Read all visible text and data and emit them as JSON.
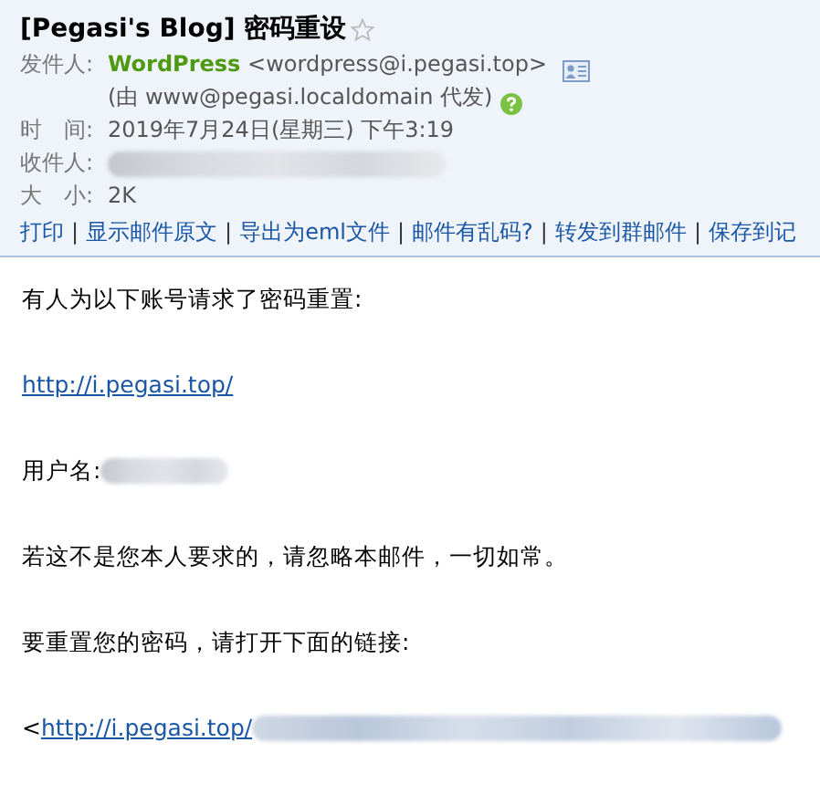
{
  "subject": {
    "title": "[Pegasi's Blog] 密码重设",
    "starred": false
  },
  "fields": [
    {
      "kind": "sender",
      "label": "发件人:",
      "name": "WordPress",
      "address": "<wordpress@i.pegasi.top>",
      "via": "(由 www@pegasi.localdomain 代发)"
    },
    {
      "kind": "text",
      "label": "时　间:",
      "value": "2019年7月24日(星期三) 下午3:19"
    },
    {
      "kind": "hidden",
      "label": "收件人:"
    },
    {
      "kind": "text",
      "label": "大　小:",
      "value": "2K"
    }
  ],
  "action_separator": "|",
  "actions": [
    "打印",
    "显示邮件原文",
    "导出为eml文件",
    "邮件有乱码?",
    "转发到群邮件",
    "保存到记"
  ],
  "body": [
    {
      "kind": "text",
      "text": "有人为以下账号请求了密码重置:"
    },
    {
      "kind": "link",
      "text": "http://i.pegasi.top/"
    },
    {
      "kind": "hidden",
      "text": "用户名:"
    },
    {
      "kind": "text",
      "text": "若这不是您本人要求的，请忽略本邮件，一切如常。"
    },
    {
      "kind": "text",
      "text": "要重置您的密码，请打开下面的链接:"
    },
    {
      "kind": "hiddenlink",
      "prefix": "<",
      "text": "http://i.pegasi.top/"
    }
  ]
}
